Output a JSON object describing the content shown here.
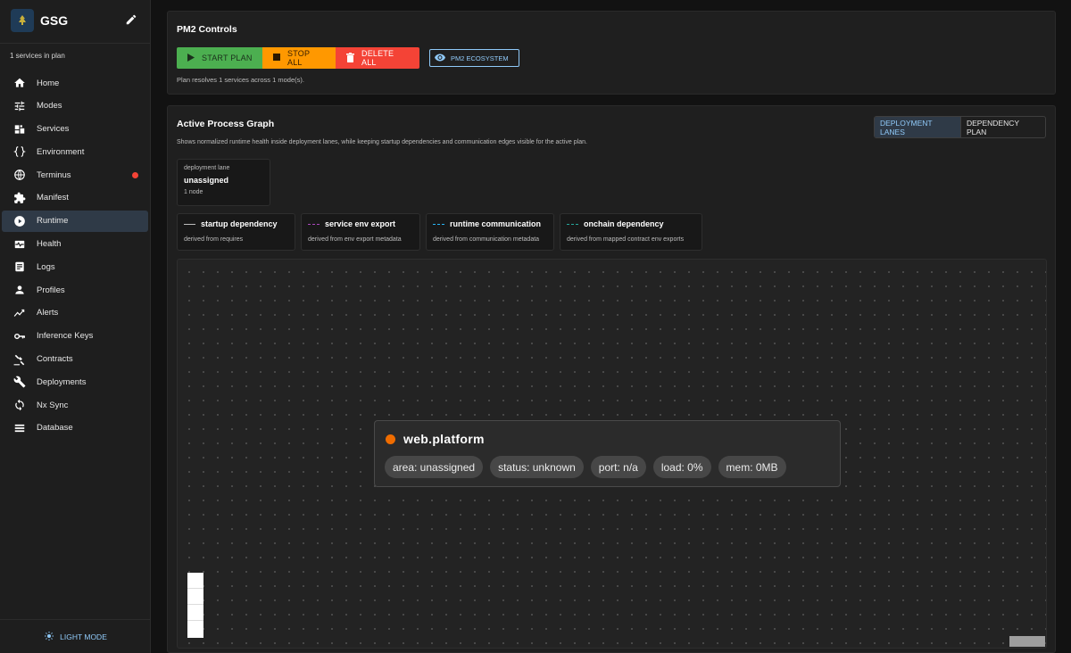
{
  "app": {
    "name": "GSG"
  },
  "sidebar": {
    "plan_count": "1 services in plan",
    "items": [
      {
        "label": "Home",
        "icon": "home-icon"
      },
      {
        "label": "Modes",
        "icon": "tune-icon"
      },
      {
        "label": "Services",
        "icon": "services-icon"
      },
      {
        "label": "Environment",
        "icon": "braces-icon"
      },
      {
        "label": "Terminus",
        "icon": "globe-icon",
        "alert": true
      },
      {
        "label": "Manifest",
        "icon": "puzzle-icon"
      },
      {
        "label": "Runtime",
        "icon": "play-circle-icon",
        "active": true
      },
      {
        "label": "Health",
        "icon": "health-icon"
      },
      {
        "label": "Logs",
        "icon": "document-icon"
      },
      {
        "label": "Profiles",
        "icon": "person-icon"
      },
      {
        "label": "Alerts",
        "icon": "trending-icon"
      },
      {
        "label": "Inference Keys",
        "icon": "key-icon"
      },
      {
        "label": "Contracts",
        "icon": "gavel-icon"
      },
      {
        "label": "Deployments",
        "icon": "wrench-icon"
      },
      {
        "label": "Nx Sync",
        "icon": "sync-icon"
      },
      {
        "label": "Database",
        "icon": "list-icon"
      }
    ],
    "footer": {
      "mode_label": "LIGHT MODE"
    }
  },
  "controls": {
    "title": "PM2 Controls",
    "start_label": "START PLAN",
    "stop_label": "STOP ALL",
    "delete_label": "DELETE ALL",
    "ecosystem_label": "PM2 ECOSYSTEM",
    "note": "Plan resolves 1 services across 1 mode(s)."
  },
  "graph": {
    "title": "Active Process Graph",
    "description": "Shows normalized runtime health inside deployment lanes, while keeping startup dependencies and communication edges visible for the active plan.",
    "toggle": {
      "lanes": "DEPLOYMENT LANES",
      "plan": "DEPENDENCY PLAN"
    },
    "lane": {
      "caption": "deployment lane",
      "name": "unassigned",
      "count": "1 node"
    },
    "legend": [
      {
        "title": "startup dependency",
        "sub": "derived from requires",
        "color": "#bdbdbd",
        "style": "solid"
      },
      {
        "title": "service env export",
        "sub": "derived from env export metadata",
        "color": "#ab47bc",
        "style": "dashed"
      },
      {
        "title": "runtime communication",
        "sub": "derived from communication metadata",
        "color": "#29b6f6",
        "style": "dashed"
      },
      {
        "title": "onchain dependency",
        "sub": "derived from mapped contract env exports",
        "color": "#26a69a",
        "style": "dashed"
      }
    ],
    "node": {
      "name": "web.platform",
      "status_color": "#ef6c00",
      "chips": [
        "area: unassigned",
        "status: unknown",
        "port: n/a",
        "load: 0%",
        "mem: 0MB"
      ]
    }
  }
}
